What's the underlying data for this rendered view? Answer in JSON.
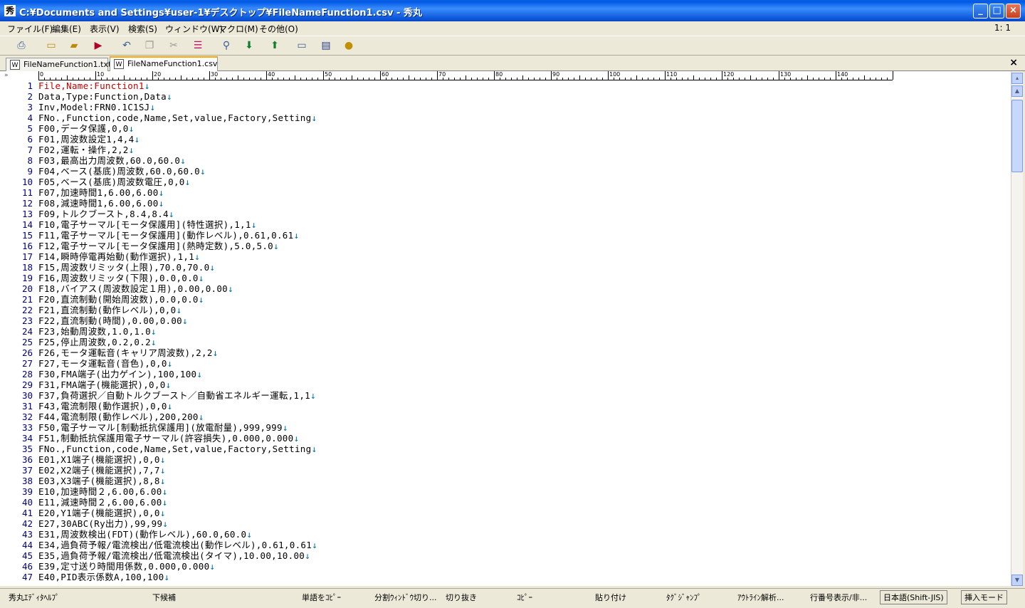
{
  "window": {
    "title": "C:¥Documents and Settings¥user-1¥デスクトップ¥FileNameFunction1.csv - 秀丸",
    "icon": "hidemaru-app-icon"
  },
  "menu": {
    "items": [
      "ファイル(F)",
      "編集(E)",
      "表示(V)",
      "検索(S)",
      "ウィンドウ(W)",
      "マクロ(M)",
      "その他(O)"
    ],
    "cursor_position": "1: 1"
  },
  "toolbar": {
    "icons": [
      "print-icon",
      "new-file-icon",
      "open-folder-icon",
      "save-icon",
      "undo-icon",
      "copy-icon",
      "cut-icon",
      "paste-icon",
      "find-icon",
      "find-next-icon",
      "find-prev-icon",
      "window-icon",
      "split-icon",
      "help-icon"
    ]
  },
  "tabs": [
    {
      "label": "FileNameFunction1.txt",
      "active": false
    },
    {
      "label": "FileNameFunction1.csv",
      "active": true
    }
  ],
  "ruler": {
    "labels": [
      "0",
      "10",
      "20",
      "30",
      "40",
      "50",
      "60",
      "70",
      "80",
      "90",
      "100",
      "110",
      "120",
      "130",
      "140"
    ]
  },
  "lines": [
    "File,Name:Function1",
    "Data,Type:Function,Data",
    "Inv,Model:FRN0.1C1SJ",
    "FNo.,Function,code,Name,Set,value,Factory,Setting",
    "F00,データ保護,0,0",
    "F01,周波数設定1,4,4",
    "F02,運転・操作,2,2",
    "F03,最高出力周波数,60.0,60.0",
    "F04,ベース(基底)周波数,60.0,60.0",
    "F05,ベース(基底)周波数電圧,0,0",
    "F07,加速時間1,6.00,6.00",
    "F08,減速時間1,6.00,6.00",
    "F09,トルクブースト,8.4,8.4",
    "F10,電子サーマル[モータ保護用](特性選択),1,1",
    "F11,電子サーマル[モータ保護用](動作レベル),0.61,0.61",
    "F12,電子サーマル[モータ保護用](熱時定数),5.0,5.0",
    "F14,瞬時停電再始動(動作選択),1,1",
    "F15,周波数リミッタ(上限),70.0,70.0",
    "F16,周波数リミッタ(下限),0.0,0.0",
    "F18,バイアス(周波数設定１用),0.00,0.00",
    "F20,直流制動(開始周波数),0.0,0.0",
    "F21,直流制動(動作レベル),0,0",
    "F22,直流制動(時間),0.00,0.00",
    "F23,始動周波数,1.0,1.0",
    "F25,停止周波数,0.2,0.2",
    "F26,モータ運転音(キャリア周波数),2,2",
    "F27,モータ運転音(音色),0,0",
    "F30,FMA端子(出力ゲイン),100,100",
    "F31,FMA端子(機能選択),0,0",
    "F37,負荷選択／自動トルクブースト／自動省エネルギー運転,1,1",
    "F43,電流制限(動作選択),0,0",
    "F44,電流制限(動作レベル),200,200",
    "F50,電子サーマル[制動抵抗保護用](放電耐量),999,999",
    "F51,制動抵抗保護用電子サーマル(許容損失),0.000,0.000",
    "FNo.,Function,code,Name,Set,value,Factory,Setting",
    "E01,X1端子(機能選択),0,0",
    "E02,X2端子(機能選択),7,7",
    "E03,X3端子(機能選択),8,8",
    "E10,加速時間２,6.00,6.00",
    "E11,減速時間２,6.00,6.00",
    "E20,Y1端子(機能選択),0,0",
    "E27,30ABC(Ry出力),99,99",
    "E31,周波数検出(FDT)(動作レベル),60.0,60.0",
    "E34,過負荷予報/電流検出/低電流検出(動作レベル),0.61,0.61",
    "E35,過負荷予報/電流検出/低電流検出(タイマ),10.00,10.00",
    "E39,定寸送り時間用係数,0.000,0.000",
    "E40,PID表示係数A,100,100"
  ],
  "eol_marker": "↓",
  "status": {
    "items": [
      "秀丸ｴﾃﾞｨﾀﾍﾙﾌﾟ",
      "下候補",
      "単語をｺﾋﾟｰ",
      "分割ｳｨﾝﾄﾞｳ切り...",
      "切り抜き",
      "ｺﾋﾟｰ",
      "貼り付け",
      "ﾀｸﾞｼﾞｬﾝﾌﾟ",
      "ｱｳﾄﾗｲﾝ解析...",
      "行番号表示/非..."
    ],
    "encoding": "日本語(Shift-JIS)",
    "mode": "挿入モード"
  },
  "colors": {
    "titlebar": "#0a5fe0",
    "first_line_text": "#c00000",
    "line_numbers": "#000080",
    "eol": "#0070a0"
  }
}
